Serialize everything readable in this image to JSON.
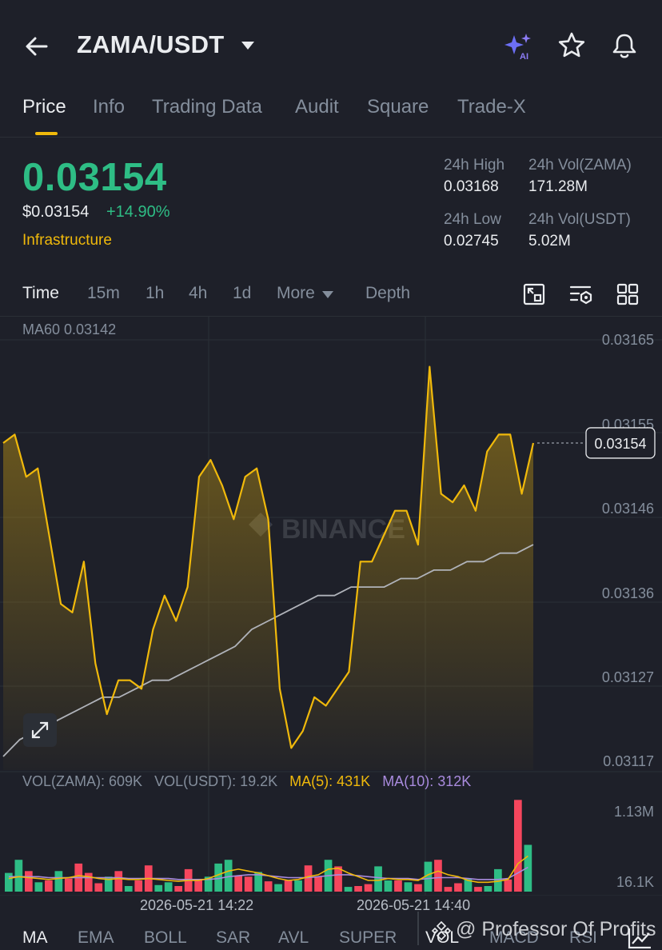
{
  "header": {
    "pair": "ZAMA/USDT",
    "icons": [
      "back-arrow-icon",
      "ai-sparkle-icon",
      "star-icon",
      "bell-icon"
    ]
  },
  "tabs": [
    "Price",
    "Info",
    "Trading Data",
    "Audit",
    "Square",
    "Trade-X"
  ],
  "active_tab": "Price",
  "price": {
    "last": "0.03154",
    "usd": "$0.03154",
    "change": "+14.90%",
    "sector": "Infrastructure",
    "high_label": "24h High",
    "high_value": "0.03168",
    "low_label": "24h Low",
    "low_value": "0.02745",
    "vol_base_label": "24h Vol(ZAMA)",
    "vol_base_value": "171.28M",
    "vol_quote_label": "24h Vol(USDT)",
    "vol_quote_value": "5.02M"
  },
  "intervals": {
    "time": "Time",
    "m15": "15m",
    "h1": "1h",
    "h4": "4h",
    "d1": "1d",
    "more": "More",
    "depth": "Depth"
  },
  "chart_legend": {
    "ma60": "MA60 0.03142"
  },
  "price_axis": [
    "0.03165",
    "0.03155",
    "0.03146",
    "0.03136",
    "0.03127",
    "0.03117"
  ],
  "last_price_tag": "0.03154",
  "watermark": "BINANCE",
  "volume_legend": {
    "base": "VOL(ZAMA): 609K",
    "quote": "VOL(USDT): 19.2K",
    "ma5": "MA(5): 431K",
    "ma10": "MA(10): 312K"
  },
  "volume_axis": {
    "top": "1.13M",
    "bottom": "16.1K"
  },
  "time_labels": [
    "2026-05-21 14:22",
    "2026-05-21 14:40"
  ],
  "indicators": [
    "MA",
    "EMA",
    "BOLL",
    "SAR",
    "AVL",
    "SUPER",
    "VOL",
    "MACD",
    "RSI"
  ],
  "overlay_text": "@ Professor Of Profits",
  "colors": {
    "up": "#2ebd85",
    "down": "#f6465d",
    "accent": "#f0b90b",
    "ma10": "#a98bde",
    "bg": "#1e2029"
  },
  "chart_data": {
    "type": "area",
    "y_range": [
      0.031154,
      0.03169
    ],
    "price_series": {
      "x": [
        0,
        1,
        2,
        3,
        4,
        5,
        6,
        7,
        8,
        9,
        10,
        11,
        12,
        13,
        14,
        15,
        16,
        17,
        18,
        19,
        20,
        21,
        22,
        23,
        24,
        25,
        26,
        27,
        28,
        29,
        30,
        31,
        32,
        33,
        34,
        35,
        36,
        37,
        38,
        39,
        40,
        41,
        42,
        43,
        44,
        45,
        46,
        47,
        48,
        49,
        50,
        51,
        52,
        53,
        54
      ],
      "y": [
        0.03154,
        0.03155,
        0.0315,
        0.03151,
        0.03143,
        0.03135,
        0.03134,
        0.0314,
        0.03128,
        0.03122,
        0.03126,
        0.03126,
        0.03125,
        0.03132,
        0.03136,
        0.03133,
        0.03137,
        0.0315,
        0.03152,
        0.03149,
        0.03145,
        0.0315,
        0.03151,
        0.03145,
        0.03125,
        0.03118,
        0.0312,
        0.03124,
        0.03123,
        0.03125,
        0.03127,
        0.0314,
        0.0314,
        0.03143,
        0.03146,
        0.03146,
        0.03142,
        0.03163,
        0.03148,
        0.03147,
        0.03149,
        0.03146,
        0.03153,
        0.03155,
        0.03155,
        0.03148,
        0.03154
      ]
    },
    "ma60_series": [
      0.03117,
      0.03119,
      0.0312,
      0.03121,
      0.03122,
      0.03123,
      0.03124,
      0.03124,
      0.03125,
      0.03126,
      0.03126,
      0.03127,
      0.03128,
      0.03129,
      0.0313,
      0.03132,
      0.03133,
      0.03134,
      0.03135,
      0.03136,
      0.03136,
      0.03137,
      0.03137,
      0.03137,
      0.03138,
      0.03138,
      0.03139,
      0.03139,
      0.0314,
      0.0314,
      0.03141,
      0.03141,
      0.03142
    ],
    "volume_bars": [
      {
        "v": 0.2,
        "up": true
      },
      {
        "v": 0.34,
        "up": true
      },
      {
        "v": 0.22,
        "up": false
      },
      {
        "v": 0.1,
        "up": true
      },
      {
        "v": 0.12,
        "up": false
      },
      {
        "v": 0.22,
        "up": true
      },
      {
        "v": 0.14,
        "up": false
      },
      {
        "v": 0.3,
        "up": false
      },
      {
        "v": 0.2,
        "up": false
      },
      {
        "v": 0.09,
        "up": false
      },
      {
        "v": 0.16,
        "up": true
      },
      {
        "v": 0.22,
        "up": false
      },
      {
        "v": 0.06,
        "up": true
      },
      {
        "v": 0.12,
        "up": false
      },
      {
        "v": 0.28,
        "up": false
      },
      {
        "v": 0.07,
        "up": true
      },
      {
        "v": 0.1,
        "up": true
      },
      {
        "v": 0.06,
        "up": false
      },
      {
        "v": 0.24,
        "up": false
      },
      {
        "v": 0.13,
        "up": false
      },
      {
        "v": 0.16,
        "up": true
      },
      {
        "v": 0.3,
        "up": true
      },
      {
        "v": 0.34,
        "up": true
      },
      {
        "v": 0.17,
        "up": false
      },
      {
        "v": 0.16,
        "up": false
      },
      {
        "v": 0.21,
        "up": true
      },
      {
        "v": 0.11,
        "up": false
      },
      {
        "v": 0.08,
        "up": true
      },
      {
        "v": 0.12,
        "up": false
      },
      {
        "v": 0.12,
        "up": true
      },
      {
        "v": 0.28,
        "up": false
      },
      {
        "v": 0.16,
        "up": false
      },
      {
        "v": 0.34,
        "up": true
      },
      {
        "v": 0.27,
        "up": false
      },
      {
        "v": 0.05,
        "up": true
      },
      {
        "v": 0.06,
        "up": false
      },
      {
        "v": 0.08,
        "up": false
      },
      {
        "v": 0.27,
        "up": true
      },
      {
        "v": 0.12,
        "up": true
      },
      {
        "v": 0.12,
        "up": false
      },
      {
        "v": 0.1,
        "up": true
      },
      {
        "v": 0.08,
        "up": false
      },
      {
        "v": 0.32,
        "up": true
      },
      {
        "v": 0.34,
        "up": false
      },
      {
        "v": 0.05,
        "up": false
      },
      {
        "v": 0.09,
        "up": false
      },
      {
        "v": 0.14,
        "up": true
      },
      {
        "v": 0.05,
        "up": false
      },
      {
        "v": 0.06,
        "up": true
      },
      {
        "v": 0.24,
        "up": true
      },
      {
        "v": 0.13,
        "up": false
      },
      {
        "v": 0.98,
        "up": false
      },
      {
        "v": 0.5,
        "up": true
      }
    ],
    "volume_ma5": [
      0.14,
      0.16,
      0.15,
      0.14,
      0.13,
      0.14,
      0.15,
      0.17,
      0.16,
      0.14,
      0.13,
      0.14,
      0.13,
      0.13,
      0.14,
      0.13,
      0.12,
      0.11,
      0.12,
      0.12,
      0.14,
      0.18,
      0.22,
      0.24,
      0.22,
      0.2,
      0.17,
      0.14,
      0.12,
      0.13,
      0.16,
      0.18,
      0.24,
      0.25,
      0.2,
      0.16,
      0.12,
      0.12,
      0.14,
      0.13,
      0.13,
      0.12,
      0.18,
      0.22,
      0.18,
      0.16,
      0.12,
      0.1,
      0.1,
      0.11,
      0.13,
      0.3,
      0.38
    ],
    "volume_ma10": [
      0.16,
      0.16,
      0.16,
      0.16,
      0.15,
      0.15,
      0.15,
      0.15,
      0.15,
      0.15,
      0.15,
      0.15,
      0.14,
      0.14,
      0.14,
      0.14,
      0.14,
      0.13,
      0.13,
      0.13,
      0.13,
      0.14,
      0.16,
      0.17,
      0.18,
      0.18,
      0.17,
      0.16,
      0.15,
      0.15,
      0.15,
      0.16,
      0.17,
      0.18,
      0.18,
      0.17,
      0.16,
      0.15,
      0.14,
      0.14,
      0.14,
      0.13,
      0.14,
      0.15,
      0.15,
      0.15,
      0.14,
      0.13,
      0.13,
      0.13,
      0.14,
      0.2,
      0.26
    ]
  }
}
